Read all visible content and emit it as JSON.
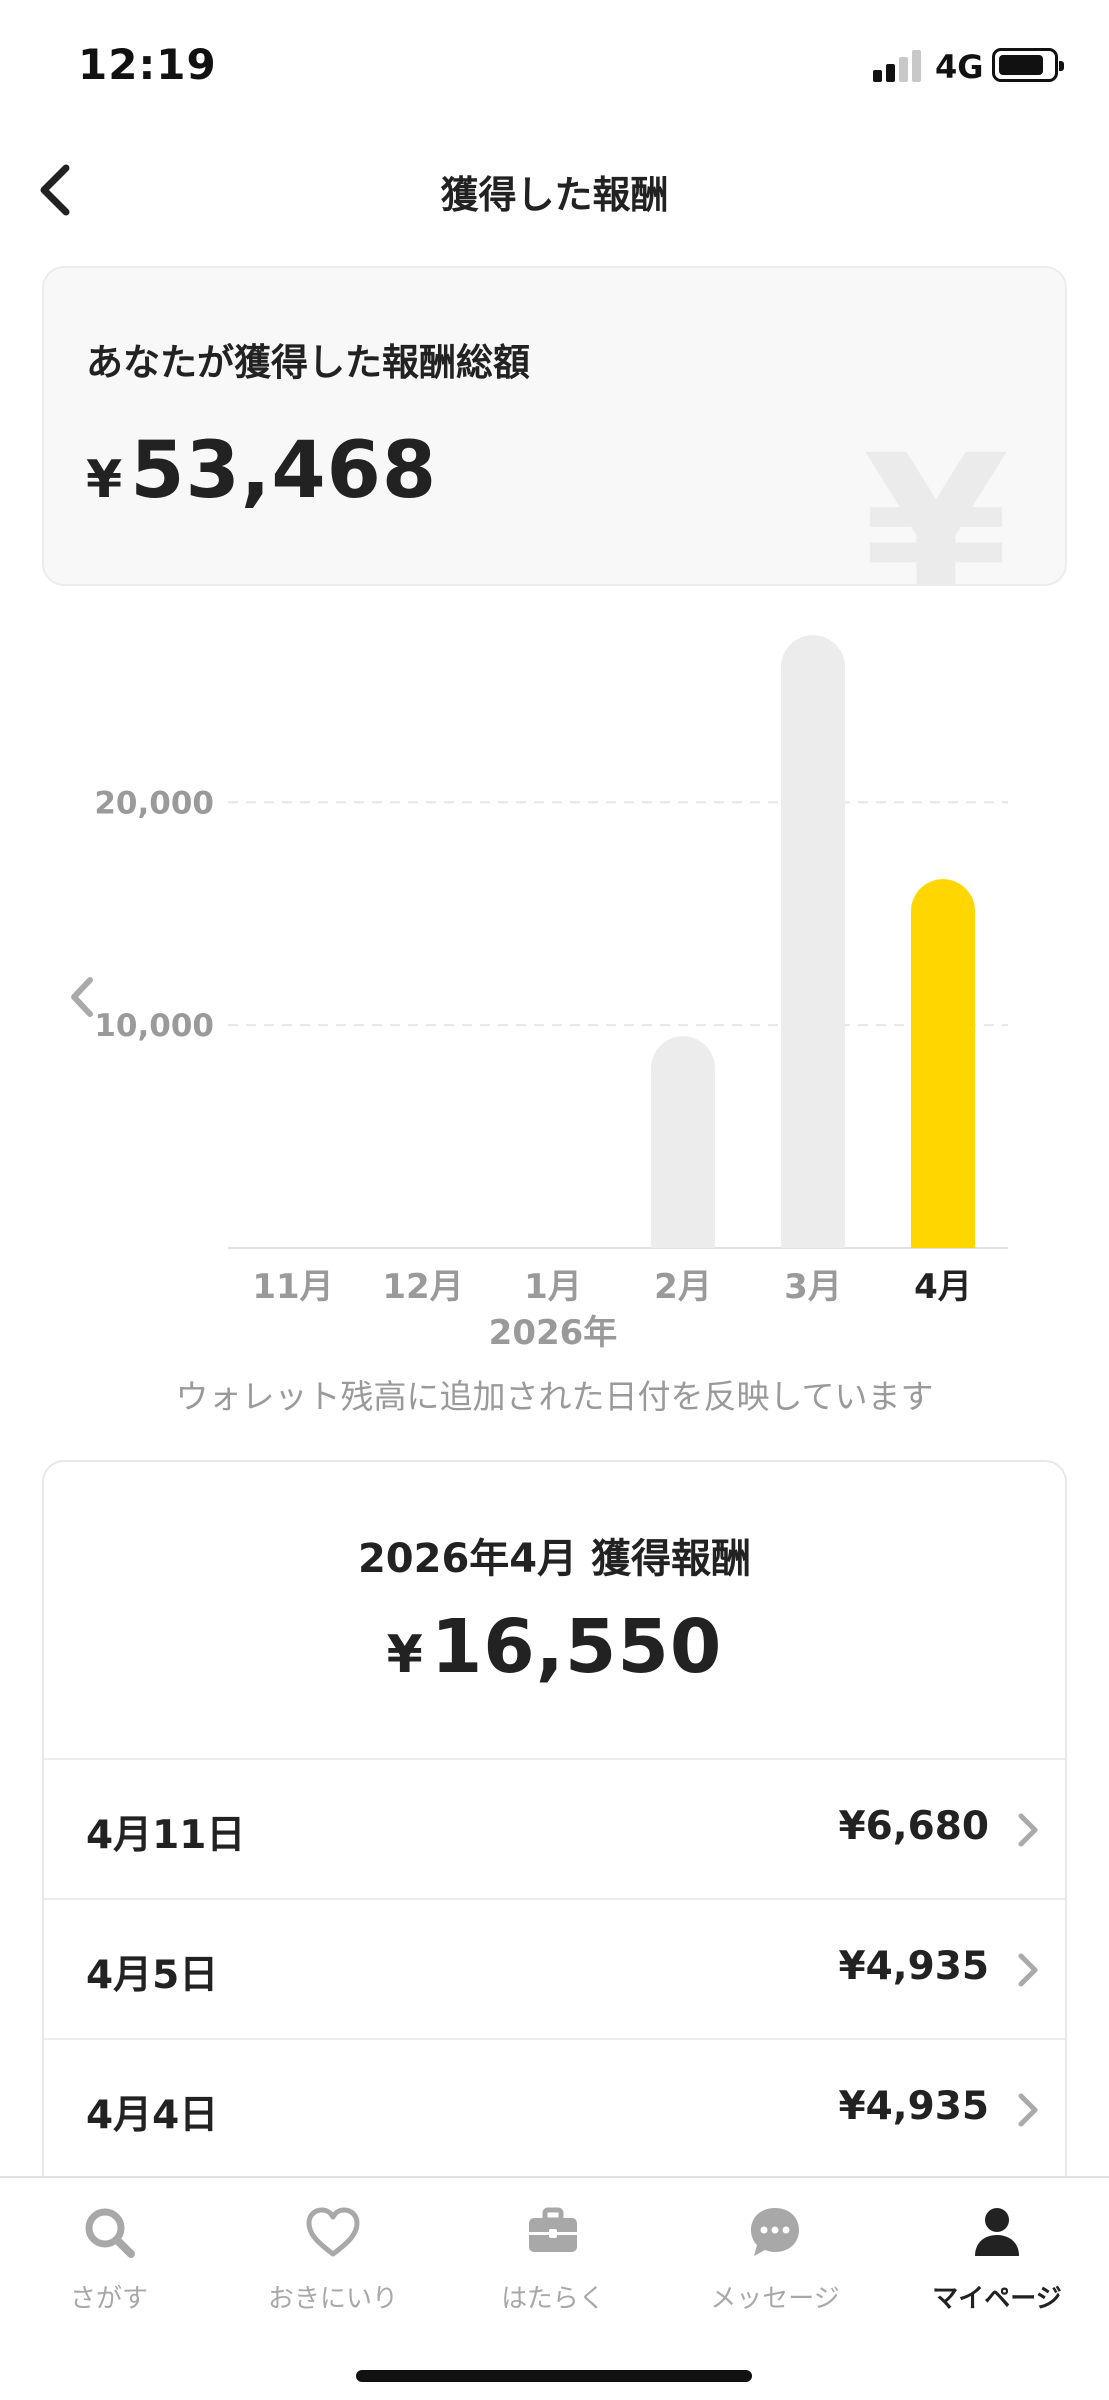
{
  "status_bar": {
    "time": "12:19",
    "network": "4G"
  },
  "header": {
    "title": "獲得した報酬"
  },
  "total_card": {
    "label": "あなたが獲得した報酬総額",
    "currency": "¥",
    "amount": "53,468",
    "watermark": "¥"
  },
  "chart_data": {
    "type": "bar",
    "categories": [
      "11月",
      "12月",
      "1月",
      "2月",
      "3月",
      "4月"
    ],
    "values": [
      0,
      0,
      0,
      9500,
      27500,
      16550
    ],
    "y_ticks": [
      {
        "value": 10000,
        "label": "10,000"
      },
      {
        "value": 20000,
        "label": "20,000"
      }
    ],
    "ylim": [
      0,
      28000
    ],
    "year_label": "2026年",
    "selected_index": 5,
    "colors": {
      "default": "#ececec",
      "selected": "#ffd600",
      "grid": "#e6e6e6",
      "axis": "#e0e0e0",
      "tick": "#9a9a9a",
      "selected_label": "#222222"
    },
    "grid": true
  },
  "chart_note": "ウォレット残高に追加された日付を反映しています",
  "month_card": {
    "title": "2026年4月 獲得報酬",
    "currency": "¥",
    "amount": "16,550",
    "rows": [
      {
        "date": "4月11日",
        "amount": "¥6,680"
      },
      {
        "date": "4月5日",
        "amount": "¥4,935"
      },
      {
        "date": "4月4日",
        "amount": "¥4,935"
      }
    ]
  },
  "tabbar": {
    "tabs": [
      {
        "label": "さがす",
        "icon": "search-icon"
      },
      {
        "label": "おきにいり",
        "icon": "heart-icon"
      },
      {
        "label": "はたらく",
        "icon": "briefcase-icon"
      },
      {
        "label": "メッセージ",
        "icon": "chat-icon"
      },
      {
        "label": "マイページ",
        "icon": "person-icon"
      }
    ],
    "active_index": 4
  }
}
